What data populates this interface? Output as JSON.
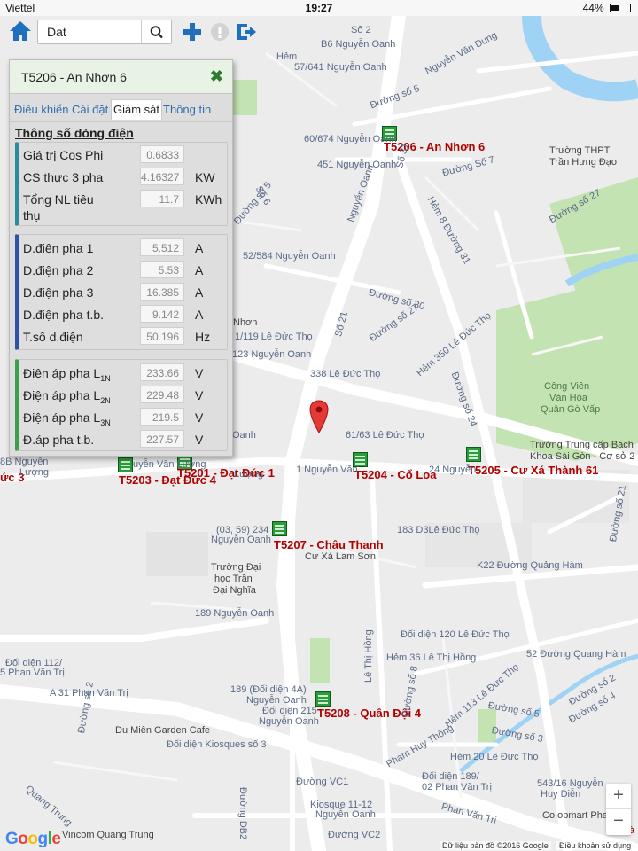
{
  "status_bar": {
    "carrier": "Viettel",
    "time": "19:27",
    "battery": "44%"
  },
  "search": {
    "value": "Dat"
  },
  "panel": {
    "title": "T5206 - An Nhơn 6",
    "tabs": [
      {
        "label": "Điều khiển"
      },
      {
        "label": "Cài đặt"
      },
      {
        "label": "Giám sát",
        "active": true
      },
      {
        "label": "Thông tin"
      }
    ],
    "section_title": "Thông số dòng điện",
    "group1": [
      {
        "label": "Giá trị Cos Phi",
        "value": "0.6833",
        "unit": ""
      },
      {
        "label": "CS thực 3 pha",
        "value": "4.16327",
        "unit": "KW"
      },
      {
        "label": "Tổng NL tiêu",
        "label2": "thụ",
        "value": "11.7",
        "unit": "KWh"
      }
    ],
    "group2": [
      {
        "label": "D.điện pha 1",
        "value": "5.512",
        "unit": "A"
      },
      {
        "label": "D.điện pha 2",
        "value": "5.53",
        "unit": "A"
      },
      {
        "label": "D.điện pha 3",
        "value": "16.385",
        "unit": "A"
      },
      {
        "label": "D.điện pha t.b.",
        "value": "9.142",
        "unit": "A"
      },
      {
        "label": "T.số d.điện",
        "value": "50.196",
        "unit": "Hz"
      }
    ],
    "group3": [
      {
        "label": "Điện áp pha L",
        "sub": "1N",
        "value": "233.66",
        "unit": "V"
      },
      {
        "label": "Điện áp pha L",
        "sub": "2N",
        "value": "229.48",
        "unit": "V"
      },
      {
        "label": "Điện áp pha L",
        "sub": "3N",
        "value": "219.5",
        "unit": "V"
      },
      {
        "label": "Đ.áp pha t.b.",
        "sub": "",
        "value": "227.57",
        "unit": "V"
      }
    ]
  },
  "stations": [
    {
      "label": "T5206 - An Nhơn 6"
    },
    {
      "label": "T5201 - Đạt Đức 1"
    },
    {
      "label": "T5203 - Đạt Đức 4"
    },
    {
      "label": "T5204 - Cổ Loa"
    },
    {
      "label": "T5205 - Cư Xá Thành 61"
    },
    {
      "label": "T5207 - Châu Thanh"
    },
    {
      "label": "T5208 - Quân Đội 4"
    },
    {
      "label": "ức 3"
    }
  ],
  "map_labels": {
    "so2": "Số 2",
    "b6": "B6 Nguyễn Oanh",
    "hem": "Hẻm",
    "nvd": "Nguyễn Văn Dung",
    "h57": "57/641 Nguyễn Oanh",
    "so5": "Đường số 5",
    "h60": "60/674 Nguyễn Oanh",
    "h451": "451 Nguyễn Oanh",
    "so6": "Số 6",
    "truong_thpt": "Trường THPT",
    "tran_hung_dao": "Trần Hưng Đạo",
    "duong_so7": "Đường Số 7",
    "duong_so27": "Đường số 27",
    "hem8_31": "Hẻm 8 Đường 31",
    "duong_so5b": "Đường số 5",
    "h52": "52/584 Nguyễn Oanh",
    "nguyen_oanh": "Nguyễn Oanh",
    "so31": "Số 31",
    "duong_so30": "Đường số 30",
    "duong_so27b": "Đường số 27",
    "so21": "Số 21",
    "nhon": "Nhơn",
    "h1_119": "1/119 Lê Đức Thọ",
    "h123": "123 Nguyễn Oanh",
    "h338": "338 Lê Đức Thọ",
    "hem350": "Hẻm 350 Lê Đức Thọ",
    "duong_so24": "Đường số 24",
    "cong_vien": "Công Viên",
    "van_hoa": "Văn Hóa",
    "quan_go_vap": "Quận Gò Vấp",
    "oanh": "Oanh",
    "h61_63": "61/63 Lê Đức Thọ",
    "truong_tc": "Trường Trung cấp Bách",
    "khoa_sg": "Khoa Sài Gòn - Cơ sở 2",
    "h8b": "8B Nguyễn",
    "luong": "Lượng",
    "nguyen_van": "uyễn Văn Lượng",
    "h1_nvl": "1 Nguyễn Văn",
    "h24": "24 Nguyễn",
    "lvl": "Lượng",
    "duong_so21": "Đường số 21",
    "h03_99": "(03, 59) 234",
    "nguyen_oanh2": "Nguyễn Oanh",
    "h183": "183 D3Lê Đức Thọ",
    "cu_xa_ls": "Cư Xá Lam Sơn",
    "truong_dh": "Trường Đại",
    "hoc_tran": "học Trần",
    "dai_nghia": "Đại Nghĩa",
    "k22": "K22 Đường Quảng Hàm",
    "h189": "189 Nguyễn Oanh",
    "doi_dien120": "Đối diện 120 Lê Đức Thọ",
    "doi_dien112": "Đối diện 112/",
    "h5_pvt": "5 Phan Văn Trị",
    "hem36": "Hẻm 36 Lê Thị Hồng",
    "le_thi_hong": "Lê Thị Hồng",
    "h52_dqh": "52 Đường Quang Hàm",
    "a31": "A 31 Phan Văn Trị",
    "h189dd": "189 (Đối diện 4A)",
    "nguyen_oanh3": "Nguyễn Oanh",
    "dd215": "Đối diện 215",
    "nguyen_oanh4": "Nguyễn Oanh",
    "hem113": "Hẻm 113 Lê Đức Thọ",
    "duong_so8": "Đường số 8",
    "duong_so5c": "Đường số 5",
    "duong_so3": "Đường số 3",
    "duong_so2": "Đường số 2",
    "duong_so4": "Đường số 4",
    "du_mien": "Du Miên Garden Cafe",
    "dd_kiosques": "Đối diện Kiosques số 3",
    "duong_so2b": "Đường số 2",
    "pham_huy_thong": "Phạm Huy Thông",
    "hem20": "Hẻm 20 Lê Đức Thọ",
    "doi_dien189": "Đối diện 189/",
    "h02_pvt": "02 Phan Văn Trị",
    "h543": "543/16 Nguyễn",
    "huy_dien": "Huy Diễn",
    "coopmart": "Co.opmart Phan",
    "quang_trung": "Quang Trung",
    "duong_vc1": "Đường VC1",
    "duong_db2": "Đường DB2",
    "kiosque": "Kiosque 11-12",
    "nguyen_oanh5": "Nguyễn Oanh",
    "phan_van_tri": "Phan Văn Trị",
    "vincom": "Vincom Quang Trung",
    "duong_vc2": "Đường VC2",
    "attrib_data": "Dữ liệu bản đồ ©2016 Google",
    "attrib_terms": "Điều khoản sử dụng",
    "nha": "Nhà"
  },
  "google_logo": "Google"
}
